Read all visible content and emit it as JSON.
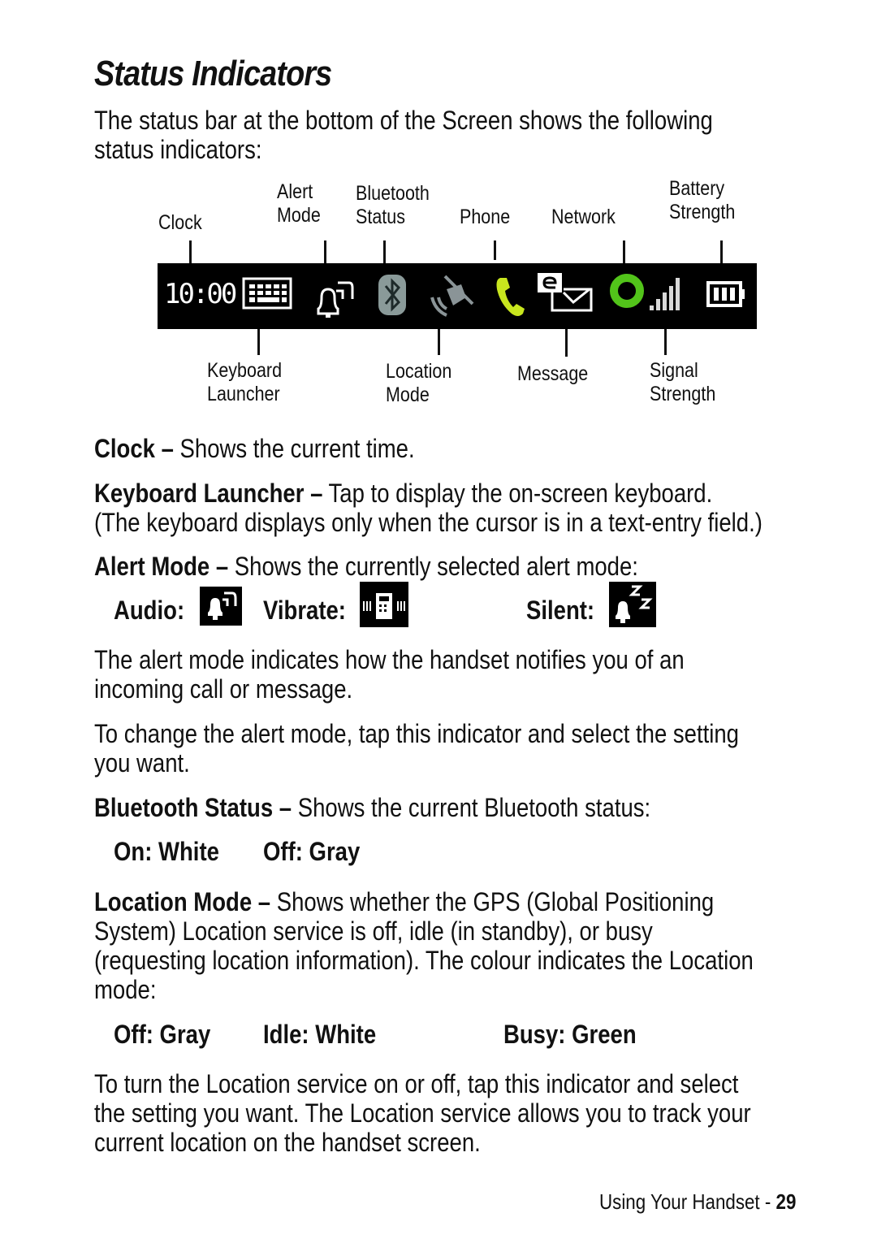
{
  "page": {
    "title": "Status Indicators",
    "intro": "The status bar at the bottom of the Screen shows the following\nstatus indicators:",
    "status_bar": {
      "clock_text": "10:00",
      "top_labels": [
        "Clock",
        "Alert\nMode",
        "Bluetooth\nStatus",
        "Phone",
        "Network",
        "Battery\nStrength"
      ],
      "bottom_labels": [
        "Keyboard\nLauncher",
        "Location\nMode",
        "Message",
        "Signal\nStrength"
      ],
      "icons": [
        "clock",
        "keyboard-icon",
        "alert-bell-icon",
        "bluetooth-icon",
        "location-satellite-icon",
        "phone-icon",
        "message-envelope-icon",
        "network-icon",
        "signal-bars-icon",
        "battery-icon"
      ],
      "colors": {
        "bar": "#000000",
        "phone": "#c8e61e",
        "network": "#52c41a",
        "bluetooth": "#8a9a99",
        "location": "#8a9497"
      }
    },
    "sections": {
      "clock": {
        "term": "Clock –",
        "text": " Shows the current time."
      },
      "keyboard": {
        "term": "Keyboard Launcher –",
        "text": " Tap to display the on-screen keyboard.\n(The keyboard displays only when the cursor is in a text-entry field.)"
      },
      "alert": {
        "term": "Alert Mode –",
        "text": " Shows the currently selected alert mode:"
      },
      "alert_modes": {
        "audio": "Audio:",
        "vibrate": "Vibrate:",
        "silent": "Silent:"
      },
      "alert_p1": "The alert mode indicates how the handset notifies you of an\nincoming call or message.",
      "alert_p2": "To change the alert mode, tap this indicator and select the setting\nyou want.",
      "bluetooth": {
        "term": "Bluetooth Status –",
        "text": " Shows the current Bluetooth status:"
      },
      "bluetooth_states": {
        "on": "On: White",
        "off": "Off: Gray"
      },
      "location": {
        "term": "Location Mode –",
        "text": " Shows whether the GPS (Global Positioning\nSystem) Location service is off, idle (in standby), or busy\n(requesting location information). The colour indicates the Location\nmode:"
      },
      "location_states": {
        "off": "Off: Gray",
        "idle": "Idle: White",
        "busy": "Busy: Green"
      },
      "location_p": "To turn the Location service on or off, tap this indicator and select\nthe setting you want. The Location service allows you to track your\ncurrent location on the handset screen."
    },
    "footer": {
      "section": "Using Your Handset - ",
      "page_number": "29"
    }
  }
}
